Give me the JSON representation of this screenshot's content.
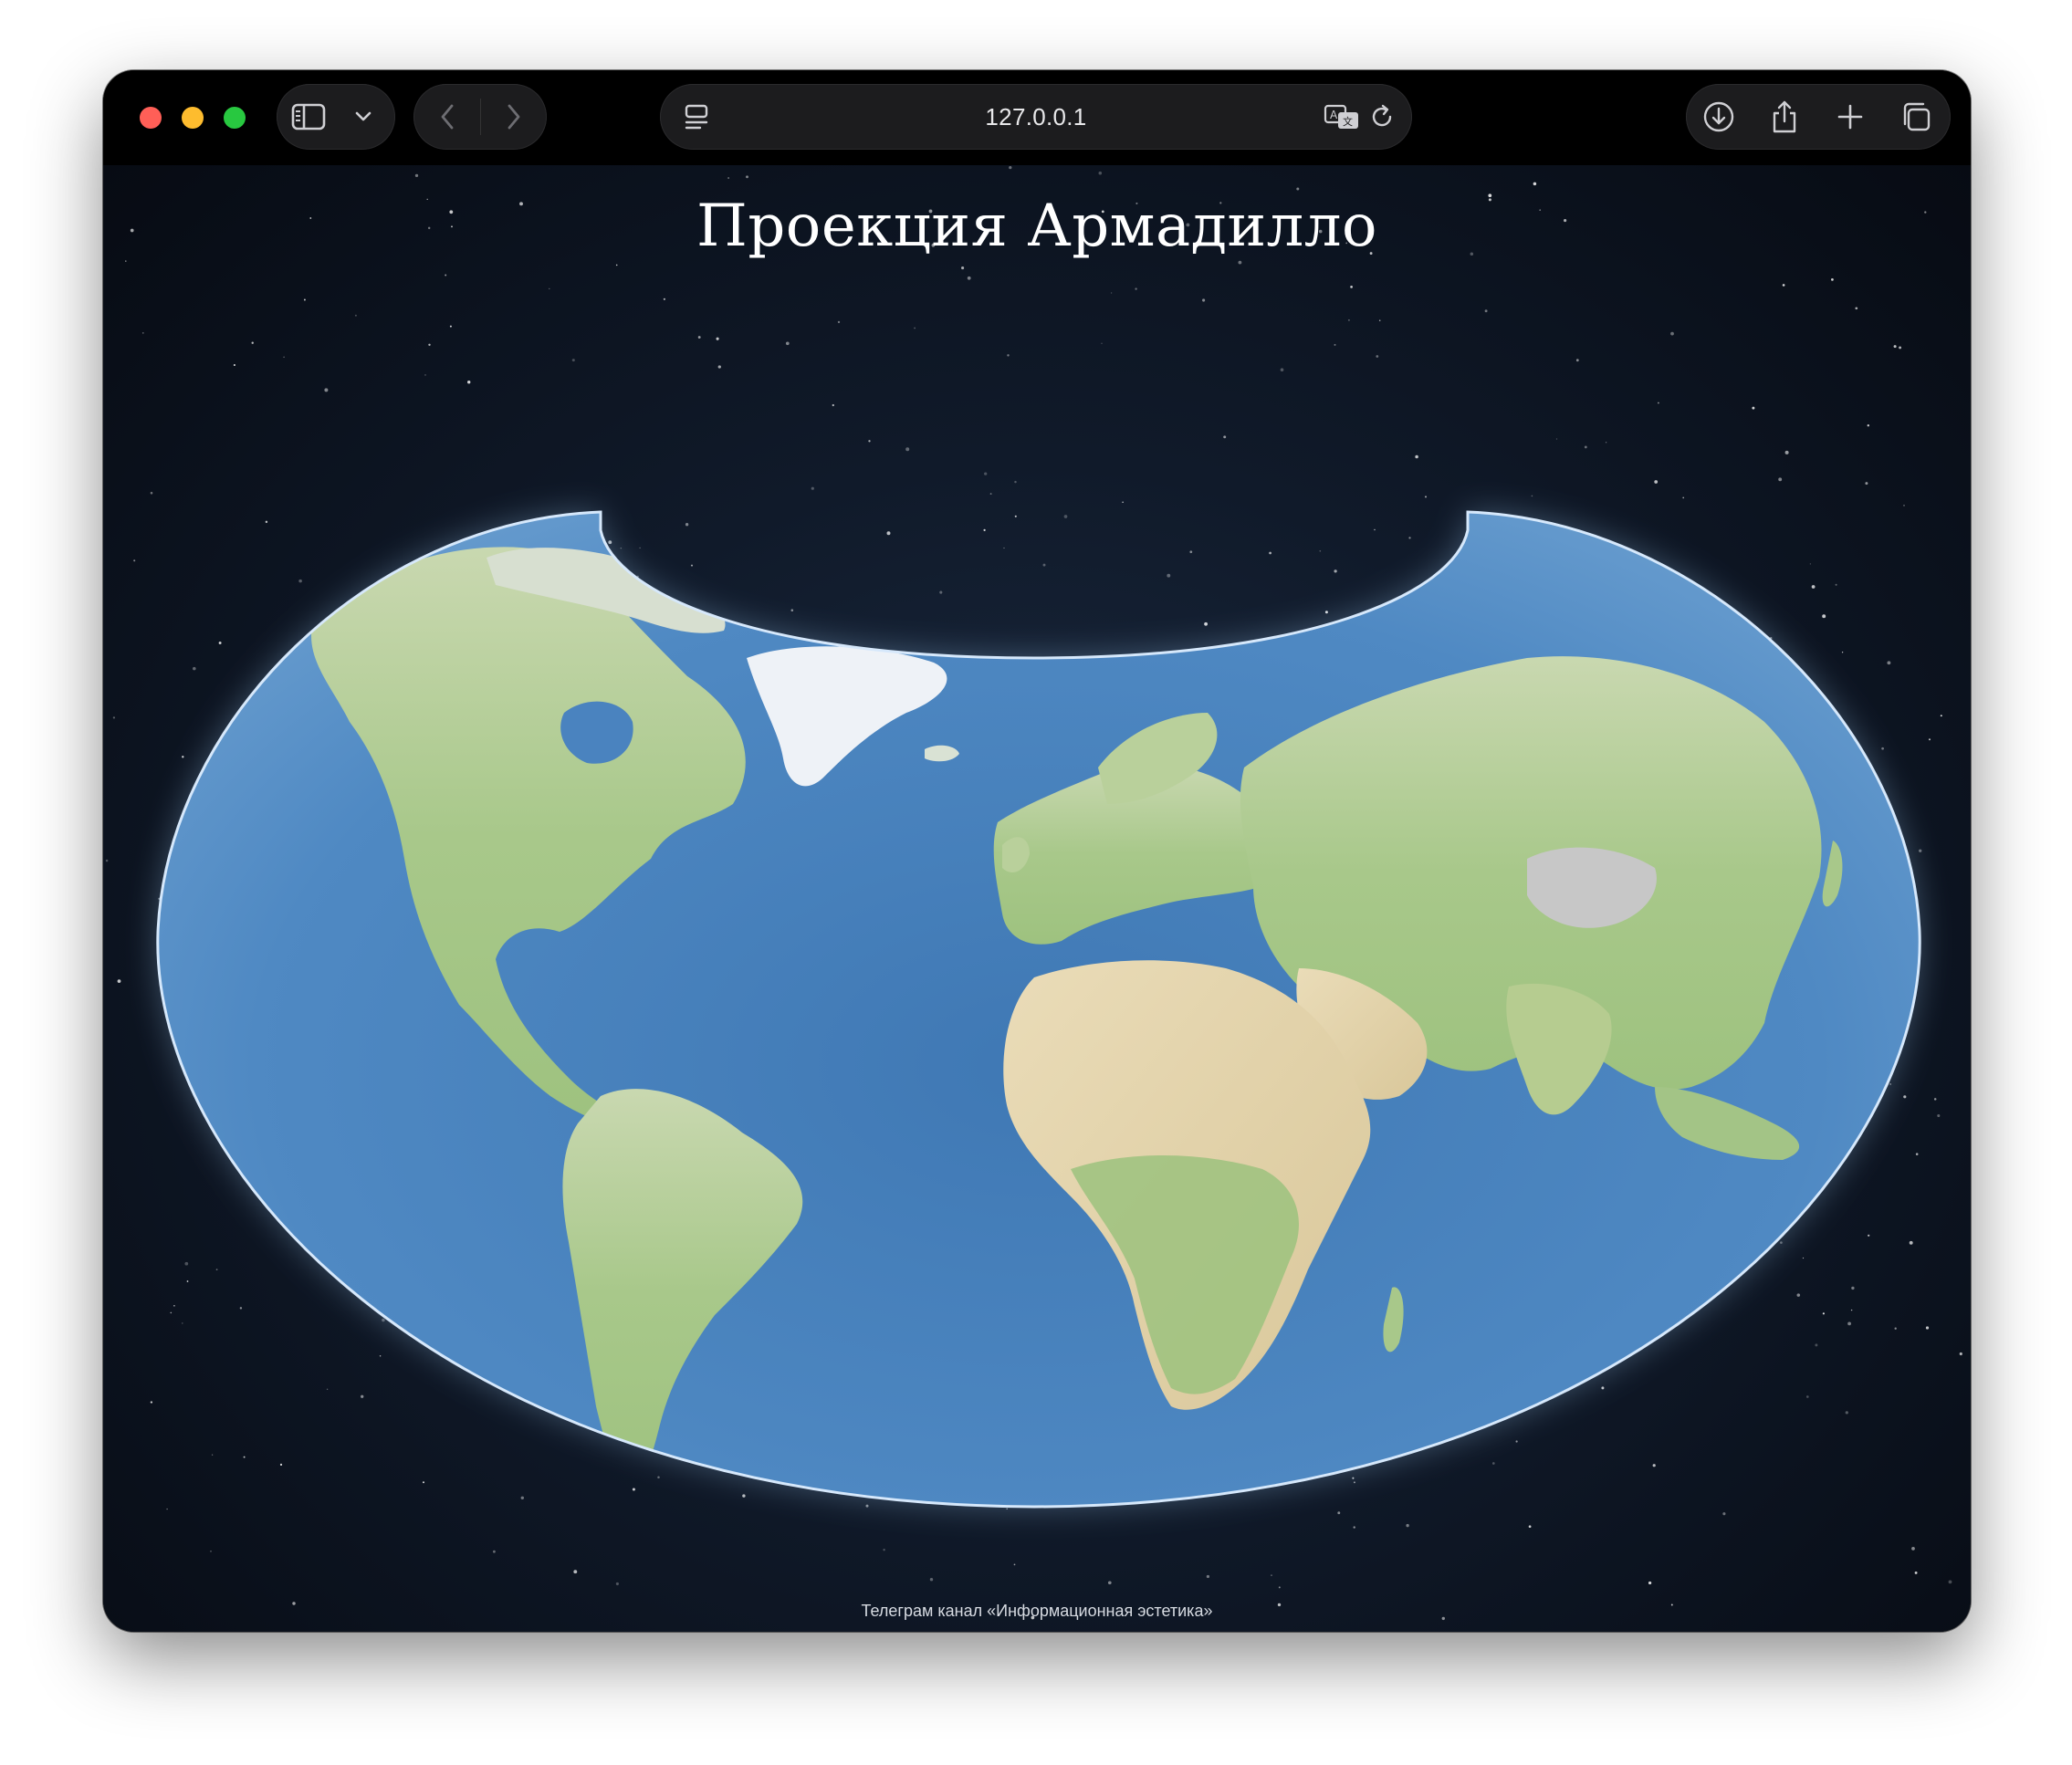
{
  "browser": {
    "address": "127.0.0.1",
    "colors": {
      "close": "#ff5f57",
      "minimize": "#febc2e",
      "zoom": "#28c840"
    },
    "icons": {
      "sidebar": "sidebar-icon",
      "chevron": "chevron-down-icon",
      "back": "chevron-left-icon",
      "forward": "chevron-right-icon",
      "page_menu": "page-menu-icon",
      "translate": "translate-icon",
      "reload": "reload-icon",
      "downloads": "download-icon",
      "share": "share-icon",
      "new_tab": "plus-icon",
      "tabs": "tabs-overview-icon"
    }
  },
  "page": {
    "title": "Проекция Армадилло",
    "footer": "Телеграм канал «Информационная эстетика»",
    "colors": {
      "ocean": "#4f86c0",
      "land": "#a9c98a",
      "ice": "#eef2f7",
      "background": "#0b1220"
    }
  }
}
